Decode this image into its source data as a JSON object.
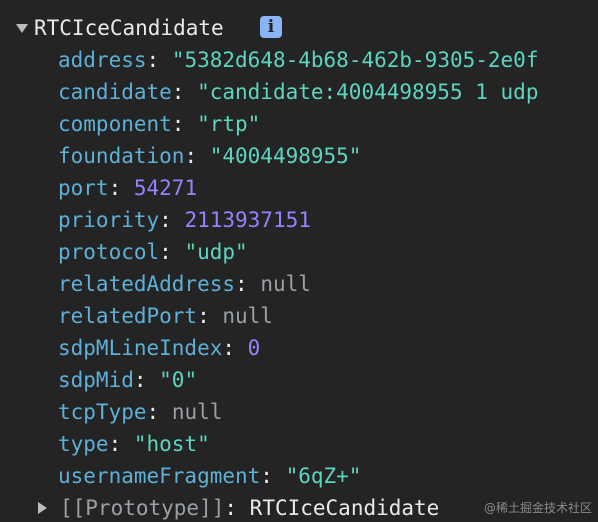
{
  "object": {
    "class_name": "RTCIceCandidate",
    "info_icon": "info-icon",
    "properties": [
      {
        "key": "address",
        "value": "\"5382d648-4b68-462b-9305-2e0f",
        "type": "string"
      },
      {
        "key": "candidate",
        "value": "\"candidate:4004498955 1 udp",
        "type": "string"
      },
      {
        "key": "component",
        "value": "\"rtp\"",
        "type": "string"
      },
      {
        "key": "foundation",
        "value": "\"4004498955\"",
        "type": "string"
      },
      {
        "key": "port",
        "value": "54271",
        "type": "number"
      },
      {
        "key": "priority",
        "value": "2113937151",
        "type": "number"
      },
      {
        "key": "protocol",
        "value": "\"udp\"",
        "type": "string"
      },
      {
        "key": "relatedAddress",
        "value": "null",
        "type": "null"
      },
      {
        "key": "relatedPort",
        "value": "null",
        "type": "null"
      },
      {
        "key": "sdpMLineIndex",
        "value": "0",
        "type": "number"
      },
      {
        "key": "sdpMid",
        "value": "\"0\"",
        "type": "string"
      },
      {
        "key": "tcpType",
        "value": "null",
        "type": "null"
      },
      {
        "key": "type",
        "value": "\"host\"",
        "type": "string"
      },
      {
        "key": "usernameFragment",
        "value": "\"6qZ+\"",
        "type": "string"
      }
    ],
    "prototype": {
      "key": "[[Prototype]]",
      "value": "RTCIceCandidate"
    }
  },
  "colors": {
    "background": "#242424",
    "key": "#5db0d7",
    "string": "#5cd5c1",
    "number": "#9980ff",
    "null": "#9aa0a6"
  },
  "watermark": "@稀土掘金技术社区"
}
